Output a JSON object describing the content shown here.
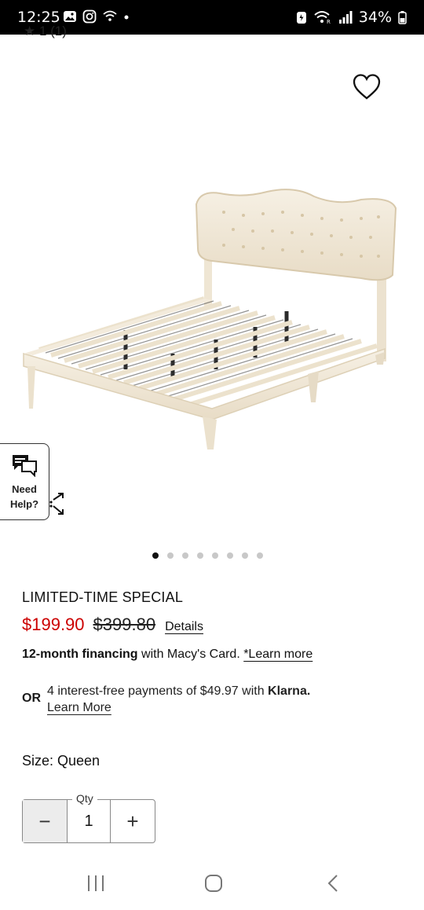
{
  "status_bar": {
    "time": "12:25",
    "battery": "34%"
  },
  "rating_peek": "★ 1 (1)",
  "help": {
    "line1": "Need",
    "line2": "Help?"
  },
  "gallery": {
    "dot_count": 8,
    "active_index": 0
  },
  "promo_label": "LIMITED-TIME SPECIAL",
  "price": {
    "sale": "$199.90",
    "original": "$399.80",
    "details_link": "Details"
  },
  "financing": {
    "bold": "12-month financing",
    "text": " with Macy's Card. ",
    "link": "*Learn more"
  },
  "klarna": {
    "or_label": "OR",
    "text": "4 interest-free payments of $49.97 with ",
    "brand": "Klarna.",
    "link": "Learn More"
  },
  "size": "Size: Queen",
  "quantity": {
    "label": "Qty",
    "value": "1",
    "minus": "−",
    "plus": "+"
  },
  "colors": {
    "sale_price": "#cc0000",
    "bed_fabric": "#f1e9da"
  }
}
